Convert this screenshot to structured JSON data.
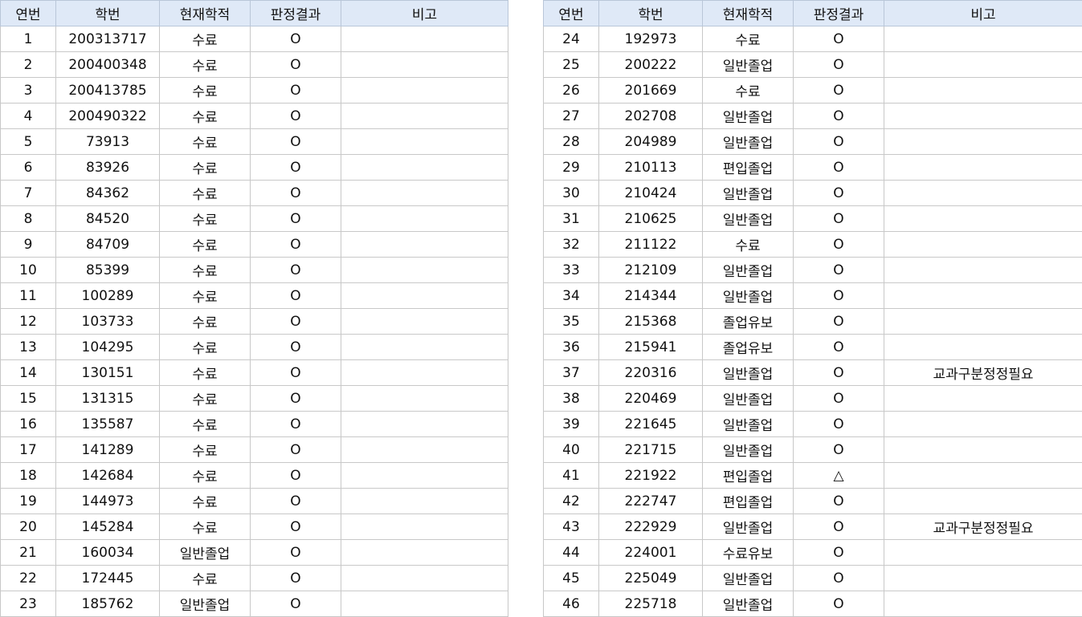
{
  "headers": [
    "연번",
    "학번",
    "현재학적",
    "판정결과",
    "비고"
  ],
  "left": [
    {
      "no": "1",
      "id": "200313717",
      "status": "수료",
      "result": "O",
      "note": ""
    },
    {
      "no": "2",
      "id": "200400348",
      "status": "수료",
      "result": "O",
      "note": ""
    },
    {
      "no": "3",
      "id": "200413785",
      "status": "수료",
      "result": "O",
      "note": ""
    },
    {
      "no": "4",
      "id": "200490322",
      "status": "수료",
      "result": "O",
      "note": ""
    },
    {
      "no": "5",
      "id": "73913",
      "status": "수료",
      "result": "O",
      "note": ""
    },
    {
      "no": "6",
      "id": "83926",
      "status": "수료",
      "result": "O",
      "note": ""
    },
    {
      "no": "7",
      "id": "84362",
      "status": "수료",
      "result": "O",
      "note": ""
    },
    {
      "no": "8",
      "id": "84520",
      "status": "수료",
      "result": "O",
      "note": ""
    },
    {
      "no": "9",
      "id": "84709",
      "status": "수료",
      "result": "O",
      "note": ""
    },
    {
      "no": "10",
      "id": "85399",
      "status": "수료",
      "result": "O",
      "note": ""
    },
    {
      "no": "11",
      "id": "100289",
      "status": "수료",
      "result": "O",
      "note": ""
    },
    {
      "no": "12",
      "id": "103733",
      "status": "수료",
      "result": "O",
      "note": ""
    },
    {
      "no": "13",
      "id": "104295",
      "status": "수료",
      "result": "O",
      "note": ""
    },
    {
      "no": "14",
      "id": "130151",
      "status": "수료",
      "result": "O",
      "note": ""
    },
    {
      "no": "15",
      "id": "131315",
      "status": "수료",
      "result": "O",
      "note": ""
    },
    {
      "no": "16",
      "id": "135587",
      "status": "수료",
      "result": "O",
      "note": ""
    },
    {
      "no": "17",
      "id": "141289",
      "status": "수료",
      "result": "O",
      "note": ""
    },
    {
      "no": "18",
      "id": "142684",
      "status": "수료",
      "result": "O",
      "note": ""
    },
    {
      "no": "19",
      "id": "144973",
      "status": "수료",
      "result": "O",
      "note": ""
    },
    {
      "no": "20",
      "id": "145284",
      "status": "수료",
      "result": "O",
      "note": ""
    },
    {
      "no": "21",
      "id": "160034",
      "status": "일반졸업",
      "result": "O",
      "note": ""
    },
    {
      "no": "22",
      "id": "172445",
      "status": "수료",
      "result": "O",
      "note": ""
    },
    {
      "no": "23",
      "id": "185762",
      "status": "일반졸업",
      "result": "O",
      "note": ""
    }
  ],
  "right": [
    {
      "no": "24",
      "id": "192973",
      "status": "수료",
      "result": "O",
      "note": ""
    },
    {
      "no": "25",
      "id": "200222",
      "status": "일반졸업",
      "result": "O",
      "note": ""
    },
    {
      "no": "26",
      "id": "201669",
      "status": "수료",
      "result": "O",
      "note": ""
    },
    {
      "no": "27",
      "id": "202708",
      "status": "일반졸업",
      "result": "O",
      "note": ""
    },
    {
      "no": "28",
      "id": "204989",
      "status": "일반졸업",
      "result": "O",
      "note": ""
    },
    {
      "no": "29",
      "id": "210113",
      "status": "편입졸업",
      "result": "O",
      "note": ""
    },
    {
      "no": "30",
      "id": "210424",
      "status": "일반졸업",
      "result": "O",
      "note": ""
    },
    {
      "no": "31",
      "id": "210625",
      "status": "일반졸업",
      "result": "O",
      "note": ""
    },
    {
      "no": "32",
      "id": "211122",
      "status": "수료",
      "result": "O",
      "note": ""
    },
    {
      "no": "33",
      "id": "212109",
      "status": "일반졸업",
      "result": "O",
      "note": ""
    },
    {
      "no": "34",
      "id": "214344",
      "status": "일반졸업",
      "result": "O",
      "note": ""
    },
    {
      "no": "35",
      "id": "215368",
      "status": "졸업유보",
      "result": "O",
      "note": ""
    },
    {
      "no": "36",
      "id": "215941",
      "status": "졸업유보",
      "result": "O",
      "note": ""
    },
    {
      "no": "37",
      "id": "220316",
      "status": "일반졸업",
      "result": "O",
      "note": "교과구분정정필요"
    },
    {
      "no": "38",
      "id": "220469",
      "status": "일반졸업",
      "result": "O",
      "note": ""
    },
    {
      "no": "39",
      "id": "221645",
      "status": "일반졸업",
      "result": "O",
      "note": ""
    },
    {
      "no": "40",
      "id": "221715",
      "status": "일반졸업",
      "result": "O",
      "note": ""
    },
    {
      "no": "41",
      "id": "221922",
      "status": "편입졸업",
      "result": "△",
      "note": ""
    },
    {
      "no": "42",
      "id": "222747",
      "status": "편입졸업",
      "result": "O",
      "note": ""
    },
    {
      "no": "43",
      "id": "222929",
      "status": "일반졸업",
      "result": "O",
      "note": "교과구분정정필요"
    },
    {
      "no": "44",
      "id": "224001",
      "status": "수료유보",
      "result": "O",
      "note": ""
    },
    {
      "no": "45",
      "id": "225049",
      "status": "일반졸업",
      "result": "O",
      "note": ""
    },
    {
      "no": "46",
      "id": "225718",
      "status": "일반졸업",
      "result": "O",
      "note": ""
    }
  ]
}
